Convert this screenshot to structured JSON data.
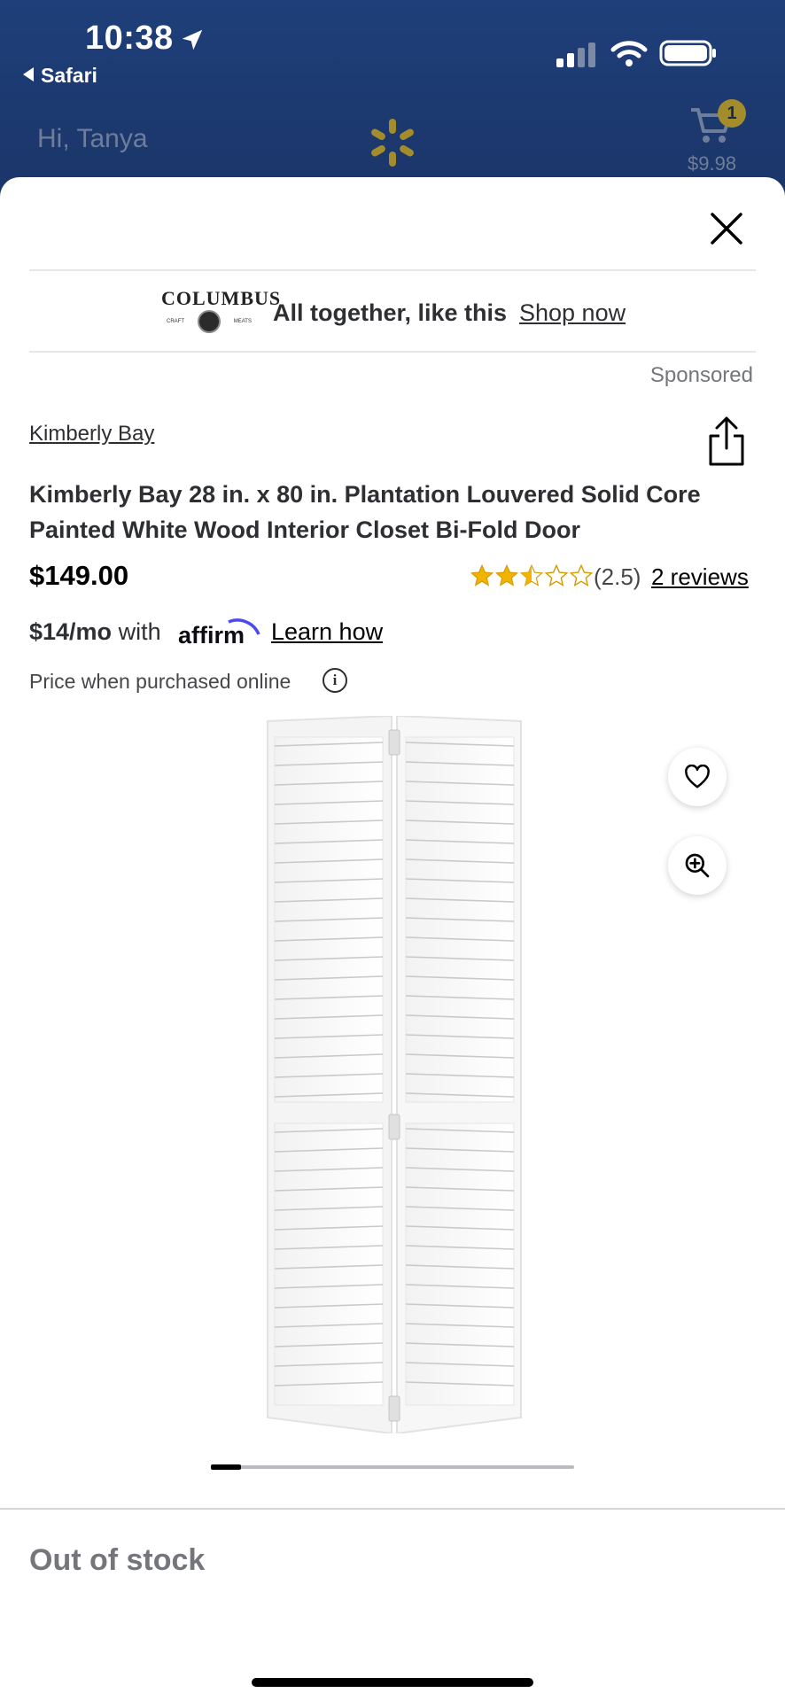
{
  "status_bar": {
    "time": "10:38",
    "back_app": "Safari"
  },
  "header": {
    "greeting": "Hi, Tanya",
    "cart_count": "1",
    "cart_total": "$9.98"
  },
  "ad": {
    "logo_word": "COLUMBUS",
    "logo_left": "CRAFT",
    "logo_right": "MEATS",
    "text": "All together, like this",
    "link": "Shop now",
    "sponsored": "Sponsored"
  },
  "product": {
    "brand": "Kimberly Bay",
    "title": "Kimberly Bay 28 in. x 80 in. Plantation Louvered Solid Core Painted White Wood Interior Closet Bi-Fold Door",
    "price": "$149.00",
    "rating_value": 2.5,
    "rating_text": "(2.5)",
    "reviews_link": "2 reviews",
    "monthly_amount": "$14/mo",
    "monthly_with": "with",
    "affirm_label": "affirm",
    "learn_how": "Learn how",
    "price_note": "Price when purchased online",
    "stock_status": "Out of stock"
  },
  "carousel": {
    "image_count_shown_fraction": 0.08
  },
  "icons": {
    "close": "close-icon",
    "share": "share-icon",
    "favorite": "heart-icon",
    "zoom": "zoom-in-icon",
    "info": "info-icon",
    "cart": "cart-icon",
    "brand_logo": "walmart-spark-icon"
  },
  "colors": {
    "header_bg": "#1f3f7a",
    "star": "#f0b400",
    "affirm_arc": "#4a4af4",
    "spark": "#a38c2b"
  }
}
